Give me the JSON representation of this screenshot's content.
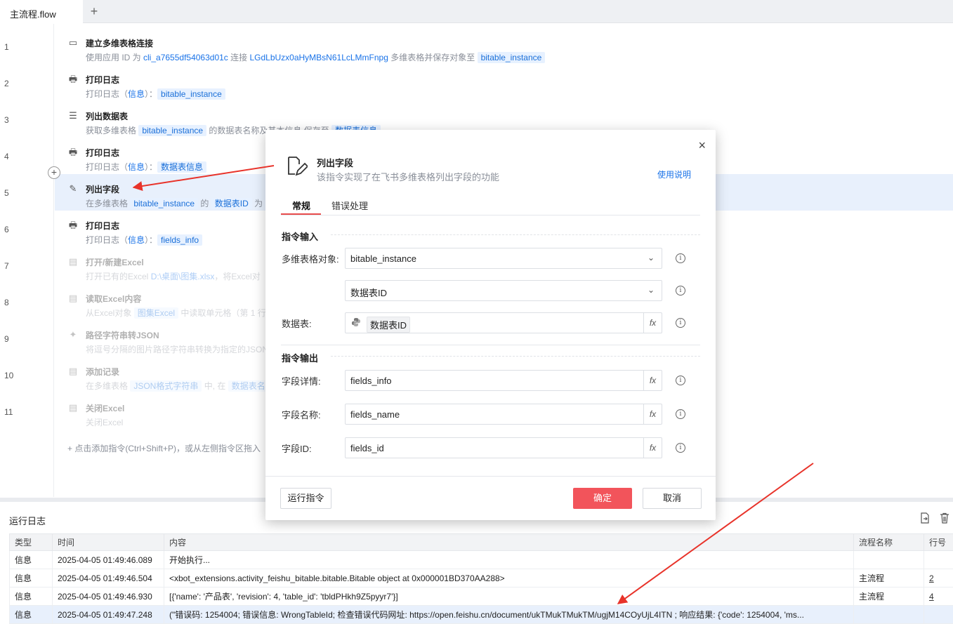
{
  "tabbar": {
    "tab_label": "主流程.flow",
    "add_label": "+"
  },
  "steps": [
    {
      "no": "1",
      "title": "建立多维表格连接",
      "desc": [
        "使用应用 ID 为 ",
        "cli_a7655df54063d01c",
        " 连接 ",
        "LGdLbUzx0aHyMBsN61LcLMmFnpg",
        " 多维表格并保存对象至 ",
        "bitable_instance"
      ]
    },
    {
      "no": "2",
      "title": "打印日志",
      "desc": [
        "打印日志（",
        "信息",
        "）：",
        "bitable_instance"
      ]
    },
    {
      "no": "3",
      "title": "列出数据表",
      "desc": [
        "获取多维表格 ",
        "bitable_instance",
        " 的数据表名称及基本信息,保存至 ",
        "数据表信息"
      ]
    },
    {
      "no": "4",
      "title": "打印日志",
      "desc": [
        "打印日志（",
        "信息",
        "）：",
        "数据表信息"
      ]
    },
    {
      "no": "5",
      "title": "列出字段",
      "desc": [
        "在多维表格 ",
        "bitable_instance",
        " 的 ",
        "数据表ID",
        " 为"
      ]
    },
    {
      "no": "6",
      "title": "打印日志",
      "desc": [
        "打印日志（",
        "信息",
        "）：",
        "fields_info"
      ]
    },
    {
      "no": "7",
      "title": "打开/新建Excel",
      "desc": [
        "打开已有的Excel ",
        "D:\\桌面\\图集.xlsx",
        "，将Excel对"
      ]
    },
    {
      "no": "8",
      "title": "读取Excel内容",
      "desc": [
        "从Excel对象 ",
        "图集Excel",
        " 中读取单元格（第 1 行"
      ]
    },
    {
      "no": "9",
      "title": "路径字符串转JSON",
      "desc": [
        "将逗号分隔的图片路径字符串转换为指定的JSON"
      ]
    },
    {
      "no": "10",
      "title": "添加记录",
      "desc": [
        "在多维表格 ",
        "JSON格式字符串",
        " 中, 在 ",
        "数据表名称"
      ]
    },
    {
      "no": "11",
      "title": "关闭Excel",
      "desc": [
        "关闭Excel"
      ]
    }
  ],
  "add_hint": "+ 点击添加指令(Ctrl+Shift+P)，或从左侧指令区拖入",
  "dialog": {
    "title": "列出字段",
    "subtitle": "该指令实现了在飞书多维表格列出字段的功能",
    "help": "使用说明",
    "close": "×",
    "tabs": [
      "常规",
      "错误处理"
    ],
    "input_section": "指令输入",
    "output_section": "指令输出",
    "inputs": {
      "bitable_label": "多维表格对象:",
      "bitable_value": "bitable_instance",
      "table_mode_value": "数据表ID",
      "table_label": "数据表:",
      "table_value": "数据表ID"
    },
    "outputs": {
      "detail_label": "字段详情:",
      "detail_value": "fields_info",
      "name_label": "字段名称:",
      "name_value": "fields_name",
      "id_label": "字段ID:",
      "id_value": "fields_id"
    },
    "fx_label": "fx",
    "info_label": "i",
    "run_button": "运行指令",
    "ok_button": "确定",
    "cancel_button": "取消"
  },
  "log": {
    "title": "运行日志",
    "columns": [
      "类型",
      "时间",
      "内容",
      "流程名称",
      "行号"
    ],
    "rows": [
      {
        "type": "信息",
        "time": "2025-04-05 01:49:46.089",
        "content": "开始执行...",
        "flow": "",
        "line": ""
      },
      {
        "type": "信息",
        "time": "2025-04-05 01:49:46.504",
        "content": "<xbot_extensions.activity_feishu_bitable.bitable.Bitable object at 0x000001BD370AA288>",
        "flow": "主流程",
        "line": "2"
      },
      {
        "type": "信息",
        "time": "2025-04-05 01:49:46.930",
        "content": "[{'name': '产品表', 'revision': 4, 'table_id': 'tbldPHkh9Z5pyyr7'}]",
        "flow": "主流程",
        "line": "4"
      },
      {
        "type": "信息",
        "time": "2025-04-05 01:49:47.248",
        "content": "(\"错误码: 1254004; 错误信息: WrongTableId; 检查错误代码网址: https://open.feishu.cn/document/ukTMukTMukTM/ugjM14COyUjL4ITN ; 响应结果: {'code': 1254004, 'ms...",
        "flow": "",
        "line": ""
      }
    ]
  },
  "colors": {
    "accent": "#1a73e8",
    "primary_button": "#f2545b",
    "selected_row": "#e8f0fc",
    "arrow": "#e8332a"
  }
}
